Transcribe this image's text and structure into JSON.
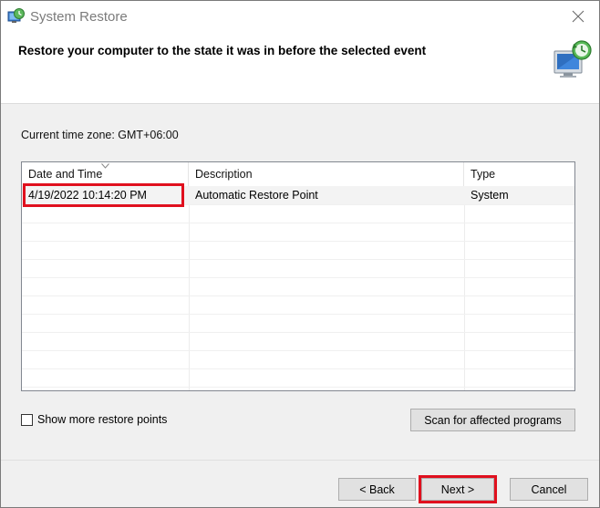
{
  "window": {
    "title": "System Restore",
    "close_glyph": "✕"
  },
  "header": {
    "title": "Restore your computer to the state it was in before the selected event"
  },
  "timezone": "Current time zone: GMT+06:00",
  "table": {
    "columns": [
      "Date and Time",
      "Description",
      "Type"
    ],
    "rows": [
      {
        "date": "4/19/2022 10:14:20 PM",
        "description": "Automatic Restore Point",
        "type": "System"
      }
    ]
  },
  "checkbox": {
    "label": "Show more restore points",
    "checked": false
  },
  "buttons": {
    "scan": "Scan for affected programs",
    "back": "< Back",
    "next": "Next >",
    "cancel": "Cancel"
  },
  "colors": {
    "highlight": "#e0101e",
    "window_bg": "#f0f0f0"
  },
  "icons": {
    "title": "system-restore-icon",
    "header": "restore-monitor-icon",
    "close": "close-icon"
  }
}
